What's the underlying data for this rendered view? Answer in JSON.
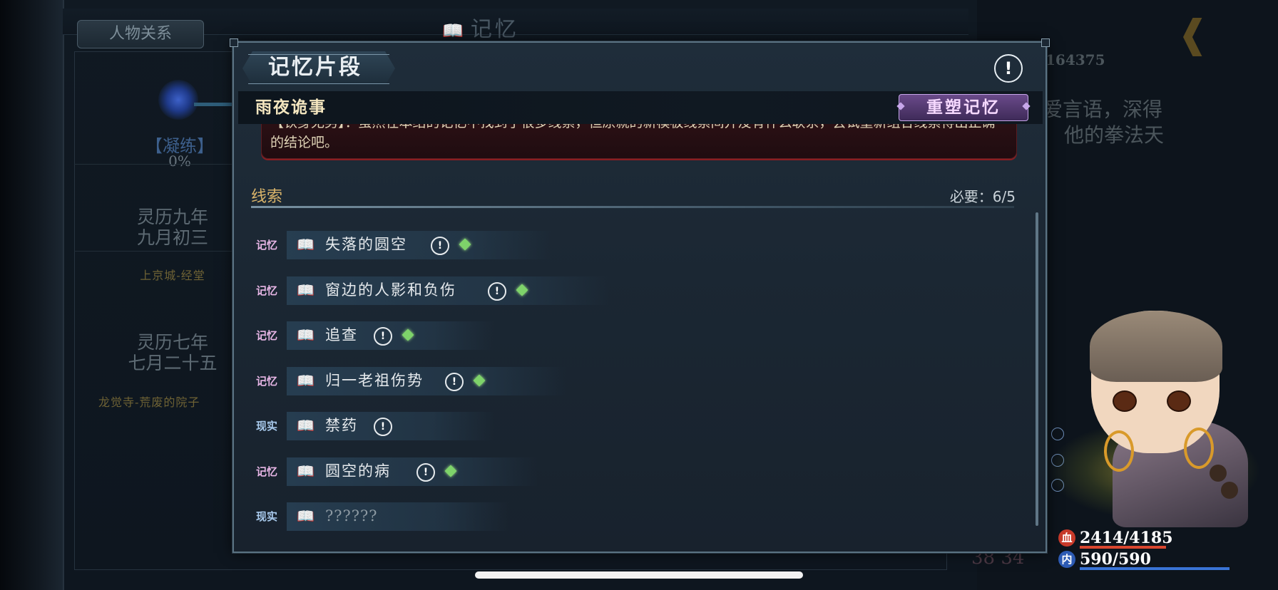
{
  "background": {
    "tab_relations": "人物关系",
    "memory_title": "记忆",
    "memory_icon": "book-icon",
    "refine_label": "【凝练】",
    "refine_percent": "0%",
    "entries": [
      {
        "date_line1": "灵历九年",
        "date_line2": "九月初三",
        "place": "上京城-经堂"
      },
      {
        "date_line1": "灵历七年",
        "date_line2": "七月二十五",
        "place": "龙觉寺-荒废的院子"
      }
    ],
    "right_number": "164375",
    "right_text_line1": "爱言语，深得",
    "right_text_line2": "他的拳法天",
    "page_number": "38 34"
  },
  "status": {
    "hp_icon_label": "血",
    "hp_value": "2414/4185",
    "hp_fraction": 0.577,
    "hp_color": "#d9472f",
    "mp_icon_label": "内",
    "mp_value": "590/590",
    "mp_fraction": 1.0,
    "mp_color": "#3a74d6"
  },
  "modal": {
    "title": "记忆片段",
    "help_icon": "!",
    "case_title": "雨夜诡事",
    "reshape_button": "重塑记忆",
    "description": "【铁身无男】：虽然在本结的记忆中找到了很多线索，但原就的新模板线索间并没有什么联系，尝试重新组合线索得出正确的结论吧。",
    "clues_label": "线索",
    "requirement": "必要：6/5",
    "clues": [
      {
        "tag": "记忆",
        "type": "memory",
        "name": "失落的圆空",
        "info": "!",
        "gem": true,
        "locked": false
      },
      {
        "tag": "记忆",
        "type": "memory",
        "name": "窗边的人影和负伤",
        "info": "!",
        "gem": true,
        "locked": false
      },
      {
        "tag": "记忆",
        "type": "memory",
        "name": "追查",
        "info": "!",
        "gem": true,
        "locked": false
      },
      {
        "tag": "记忆",
        "type": "memory",
        "name": "归一老祖伤势",
        "info": "!",
        "gem": true,
        "locked": false
      },
      {
        "tag": "现实",
        "type": "reality",
        "name": "禁药",
        "info": "!",
        "gem": false,
        "locked": false
      },
      {
        "tag": "记忆",
        "type": "memory",
        "name": "圆空的病",
        "info": "!",
        "gem": true,
        "locked": false
      },
      {
        "tag": "现实",
        "type": "reality",
        "name": "??????",
        "info": "",
        "gem": false,
        "locked": true
      }
    ]
  }
}
